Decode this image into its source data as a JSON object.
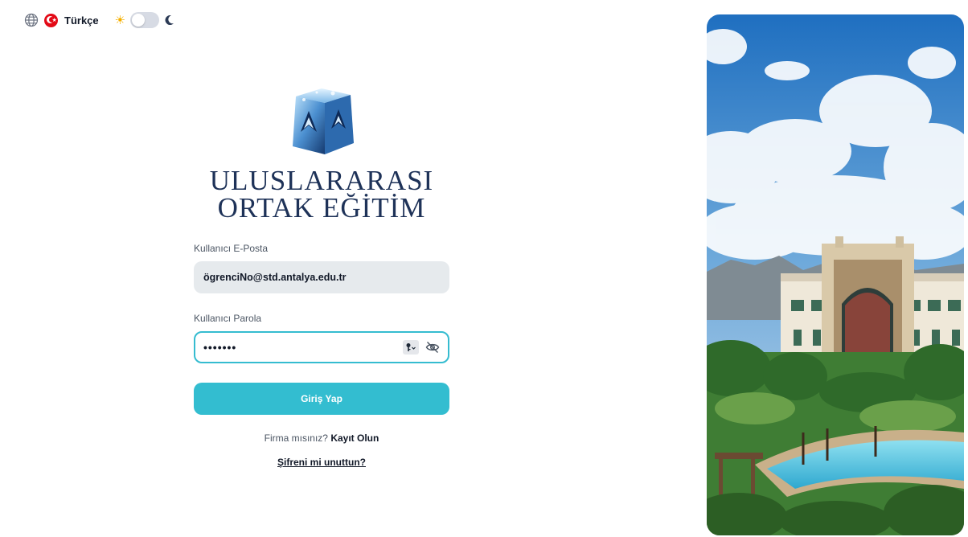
{
  "topbar": {
    "language": "Türkçe",
    "icons": [
      "globe-icon",
      "turkey-flag-icon",
      "sun-icon",
      "moon-icon"
    ],
    "theme_toggle": "light"
  },
  "logo": {
    "line1": "ULUSLARARASI",
    "line2": "ORTAK EĞİTİM"
  },
  "form": {
    "email_label": "Kullanıcı E-Posta",
    "email_value": "ögrenciNo@std.antalya.edu.tr",
    "password_label": "Kullanıcı Parola",
    "password_value": "•••••••",
    "submit_label": "Giriş Yap",
    "signup_prompt": "Firma mısınız?",
    "signup_link": "Kayıt Olun",
    "forgot_link": "Şifreni mi unuttun?"
  },
  "colors": {
    "accent": "#33bdd0",
    "logo_text": "#1e3258",
    "input_bg": "#e6eaed"
  }
}
